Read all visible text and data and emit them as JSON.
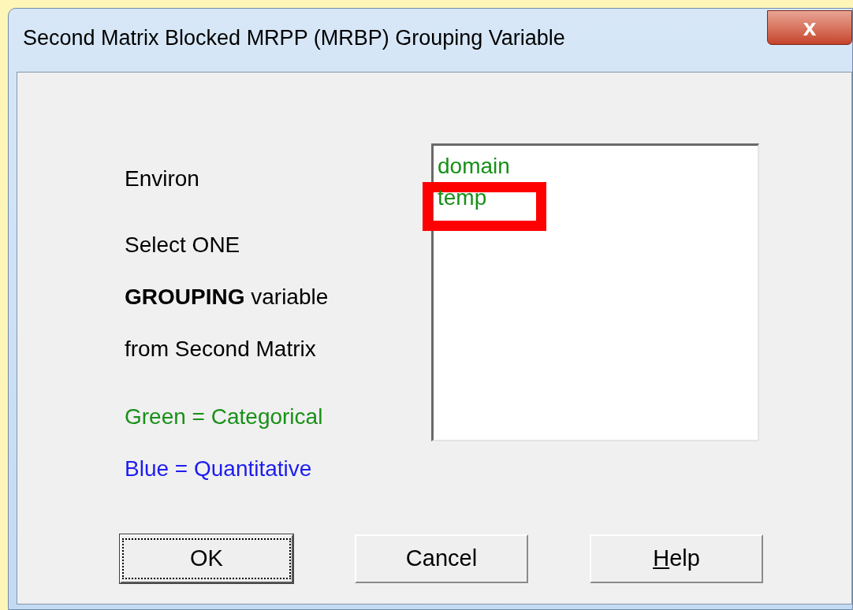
{
  "window": {
    "title": "Second Matrix Blocked MRPP (MRBP) Grouping Variable",
    "close_label": "x"
  },
  "matrix_name": "Environ",
  "instructions": [
    "Select ONE",
    "**GROUPING** variable",
    "from Second Matrix"
  ],
  "legend": [
    {
      "text": "Green = Categorical",
      "color": "#189018"
    },
    {
      "text": "Blue = Quantitative",
      "color": "#1c1cf0"
    }
  ],
  "variables": [
    {
      "name": "domain",
      "color": "#189018",
      "highlighted": false
    },
    {
      "name": "temp",
      "color": "#189018",
      "highlighted": true
    }
  ],
  "buttons": [
    {
      "label": "OK",
      "default": true
    },
    {
      "label": "Cancel",
      "default": false
    },
    {
      "underlined": "H",
      "label_rest": "elp",
      "default": false
    }
  ]
}
